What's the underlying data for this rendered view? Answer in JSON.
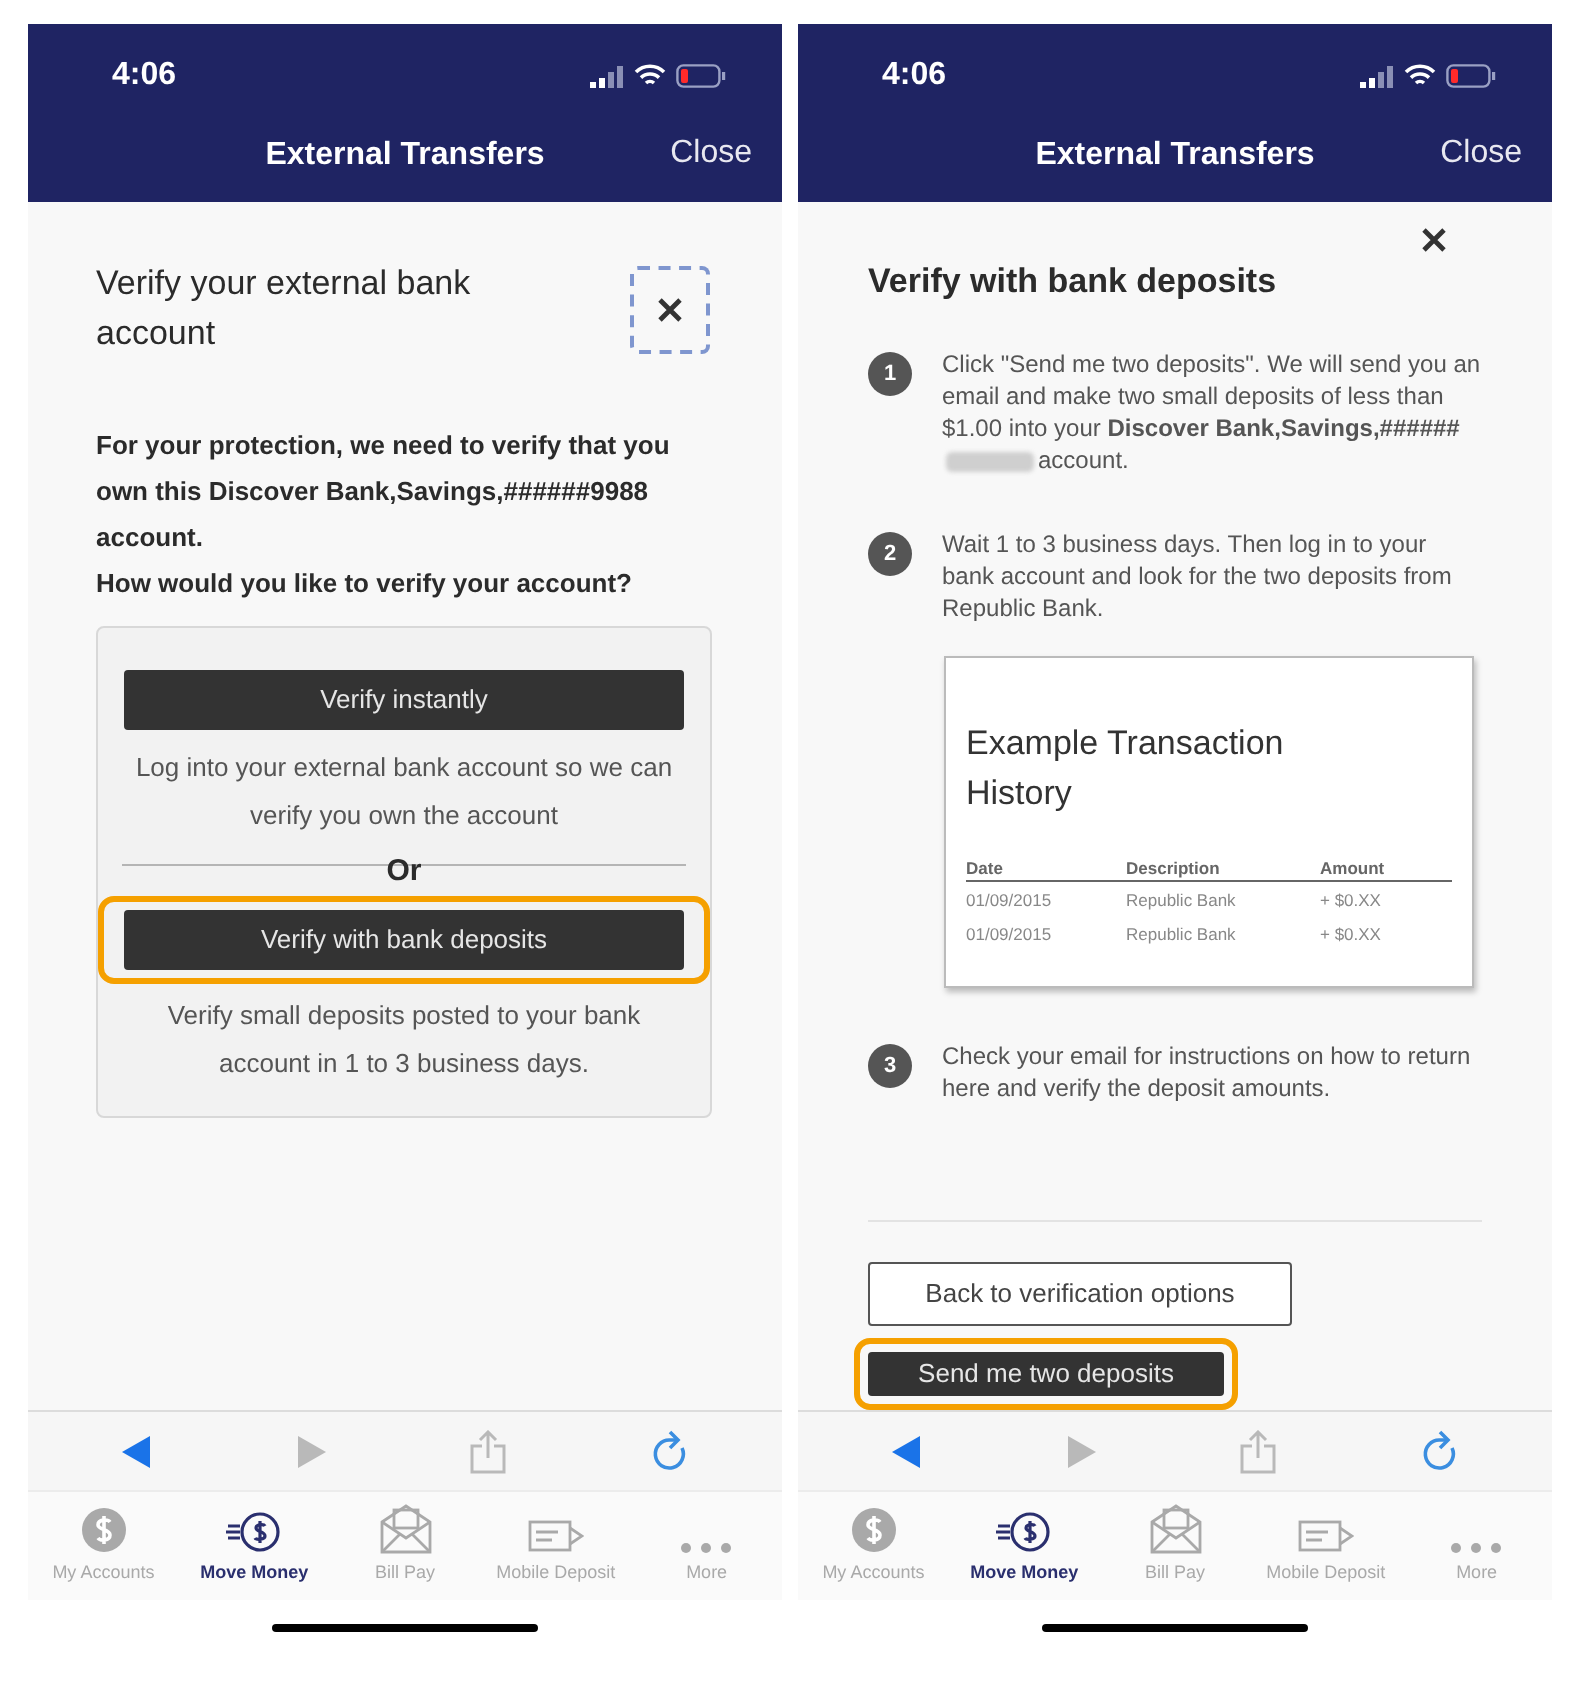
{
  "screens": [
    {
      "status_bar": {
        "time": "4:06"
      },
      "nav": {
        "title": "External Transfers",
        "close": "Close"
      },
      "kind": "options",
      "dialog": {
        "close_focused": true,
        "title": "Verify your external bank account",
        "intro": [
          "For your protection, we need to verify that you own this Discover Bank,Savings,######9988 account.",
          "How would you like to verify your account?"
        ],
        "options": [
          {
            "button": "Verify instantly",
            "highlighted": false,
            "description": "Log into your external bank account so we can verify you own the account"
          },
          {
            "button": "Verify with bank deposits",
            "highlighted": true,
            "description": "Verify small deposits posted to your bank account in 1 to 3 business days."
          }
        ],
        "separator": "Or"
      },
      "toolbar": [
        {
          "kind": "back",
          "disabled": false
        },
        {
          "kind": "forward",
          "disabled": true
        },
        {
          "kind": "share",
          "disabled": true
        },
        {
          "kind": "refresh",
          "disabled": false
        }
      ],
      "tabs": [
        {
          "kind": "accounts",
          "label": "My Accounts",
          "selected": false
        },
        {
          "kind": "move",
          "label": "Move Money",
          "selected": true
        },
        {
          "kind": "bills",
          "label": "Bill Pay",
          "selected": false
        },
        {
          "kind": "deposit",
          "label": "Mobile Deposit",
          "selected": false
        },
        {
          "kind": "more",
          "label": "More",
          "selected": false
        }
      ]
    },
    {
      "status_bar": {
        "time": "4:06"
      },
      "nav": {
        "title": "External Transfers",
        "close": "Close"
      },
      "kind": "deposits",
      "dialog": {
        "close_focused": false,
        "title": "Verify with bank deposits",
        "sections": [
          {
            "kind": "step",
            "number": "1",
            "text": "Click \"Send me two deposits\". We will send you an email and make two small deposits of less than $1.00 into your **Discover Bank,Savings,######**",
            "redacted": true,
            "text_after": "account."
          },
          {
            "kind": "step",
            "number": "2",
            "text": "Wait 1 to 3 business days. Then log in to your bank account and look for the two deposits from Republic Bank."
          },
          {
            "kind": "example",
            "title": "Example Transaction History",
            "columns": [
              "Date",
              "Description",
              "Amount"
            ],
            "rows": [
              [
                "01/09/2015",
                "Republic Bank",
                "+ $0.XX"
              ],
              [
                "01/09/2015",
                "Republic Bank",
                "+ $0.XX"
              ]
            ]
          },
          {
            "kind": "step",
            "number": "3",
            "text": "Check your email for instructions on how to return here and verify the deposit amounts."
          }
        ],
        "buttons": [
          {
            "kind": "outline",
            "label": "Back to verification options",
            "highlighted": false
          },
          {
            "kind": "primary",
            "label": "Send me two deposits",
            "highlighted": true
          }
        ]
      },
      "toolbar": [
        {
          "kind": "back",
          "disabled": false
        },
        {
          "kind": "forward",
          "disabled": true
        },
        {
          "kind": "share",
          "disabled": true
        },
        {
          "kind": "refresh",
          "disabled": false
        }
      ],
      "tabs": [
        {
          "kind": "accounts",
          "label": "My Accounts",
          "selected": false
        },
        {
          "kind": "move",
          "label": "Move Money",
          "selected": true
        },
        {
          "kind": "bills",
          "label": "Bill Pay",
          "selected": false
        },
        {
          "kind": "deposit",
          "label": "Mobile Deposit",
          "selected": false
        },
        {
          "kind": "more",
          "label": "More",
          "selected": false
        }
      ]
    }
  ]
}
